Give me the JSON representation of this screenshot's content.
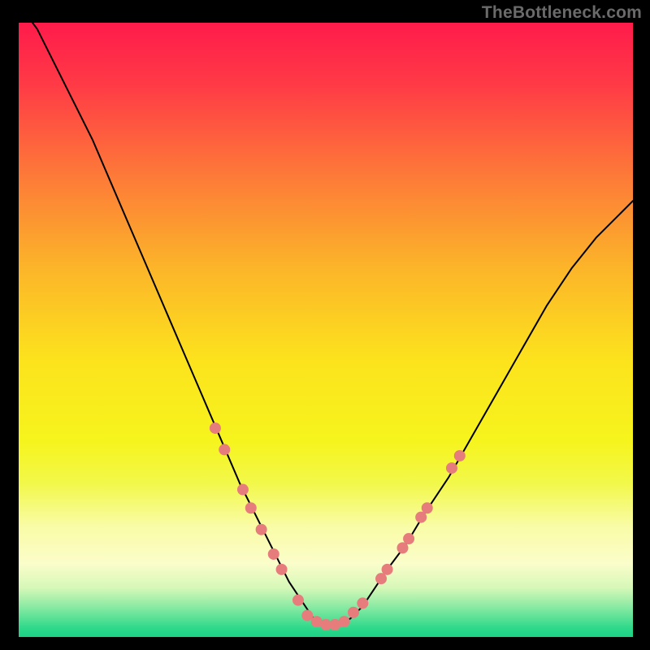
{
  "watermark": "TheBottleneck.com",
  "chart_data": {
    "type": "line",
    "title": "",
    "xlabel": "",
    "ylabel": "",
    "xlim": [
      0,
      100
    ],
    "ylim": [
      0,
      100
    ],
    "grid": false,
    "legend": false,
    "background": {
      "type": "vertical-gradient",
      "stops": [
        {
          "offset": 0.0,
          "color": "#ff1b4b"
        },
        {
          "offset": 0.1,
          "color": "#ff3a46"
        },
        {
          "offset": 0.25,
          "color": "#fd7a38"
        },
        {
          "offset": 0.4,
          "color": "#fcb529"
        },
        {
          "offset": 0.55,
          "color": "#fce31d"
        },
        {
          "offset": 0.68,
          "color": "#f6f41d"
        },
        {
          "offset": 0.75,
          "color": "#f2f84a"
        },
        {
          "offset": 0.82,
          "color": "#f9fca6"
        },
        {
          "offset": 0.88,
          "color": "#fbfdca"
        },
        {
          "offset": 0.92,
          "color": "#d6f8b8"
        },
        {
          "offset": 0.955,
          "color": "#7fe8a0"
        },
        {
          "offset": 0.985,
          "color": "#2fd98b"
        },
        {
          "offset": 1.0,
          "color": "#1bd185"
        }
      ]
    },
    "series": [
      {
        "name": "bottleneck-curve",
        "color": "#000000",
        "stroke_width": 2,
        "x": [
          0,
          3,
          6,
          9,
          12,
          15,
          18,
          21,
          24,
          27,
          30,
          33,
          36,
          38,
          40,
          42,
          44,
          46,
          48,
          50,
          52,
          54,
          56,
          58,
          60,
          63,
          66,
          70,
          74,
          78,
          82,
          86,
          90,
          94,
          98,
          100
        ],
        "y": [
          103,
          99,
          93,
          87,
          81,
          74,
          67,
          60,
          53,
          46,
          39,
          32,
          25,
          21,
          17,
          13,
          9,
          6,
          3,
          2,
          2,
          3,
          5,
          8,
          11,
          15,
          20,
          26,
          33,
          40,
          47,
          54,
          60,
          65,
          69,
          71
        ]
      }
    ],
    "marker_series": [
      {
        "name": "curve-markers",
        "color": "#e77c7c",
        "radius": 7,
        "points": [
          {
            "x": 32.0,
            "y": 34.0
          },
          {
            "x": 33.5,
            "y": 30.5
          },
          {
            "x": 36.5,
            "y": 24.0
          },
          {
            "x": 37.8,
            "y": 21.0
          },
          {
            "x": 39.5,
            "y": 17.5
          },
          {
            "x": 41.5,
            "y": 13.5
          },
          {
            "x": 42.8,
            "y": 11.0
          },
          {
            "x": 45.5,
            "y": 6.0
          },
          {
            "x": 47.0,
            "y": 3.5
          },
          {
            "x": 48.5,
            "y": 2.5
          },
          {
            "x": 50.0,
            "y": 2.0
          },
          {
            "x": 51.5,
            "y": 2.0
          },
          {
            "x": 53.0,
            "y": 2.5
          },
          {
            "x": 54.5,
            "y": 4.0
          },
          {
            "x": 56.0,
            "y": 5.5
          },
          {
            "x": 59.0,
            "y": 9.5
          },
          {
            "x": 60.0,
            "y": 11.0
          },
          {
            "x": 62.5,
            "y": 14.5
          },
          {
            "x": 63.5,
            "y": 16.0
          },
          {
            "x": 65.5,
            "y": 19.5
          },
          {
            "x": 66.5,
            "y": 21.0
          },
          {
            "x": 70.5,
            "y": 27.5
          },
          {
            "x": 71.8,
            "y": 29.5
          }
        ]
      }
    ]
  }
}
